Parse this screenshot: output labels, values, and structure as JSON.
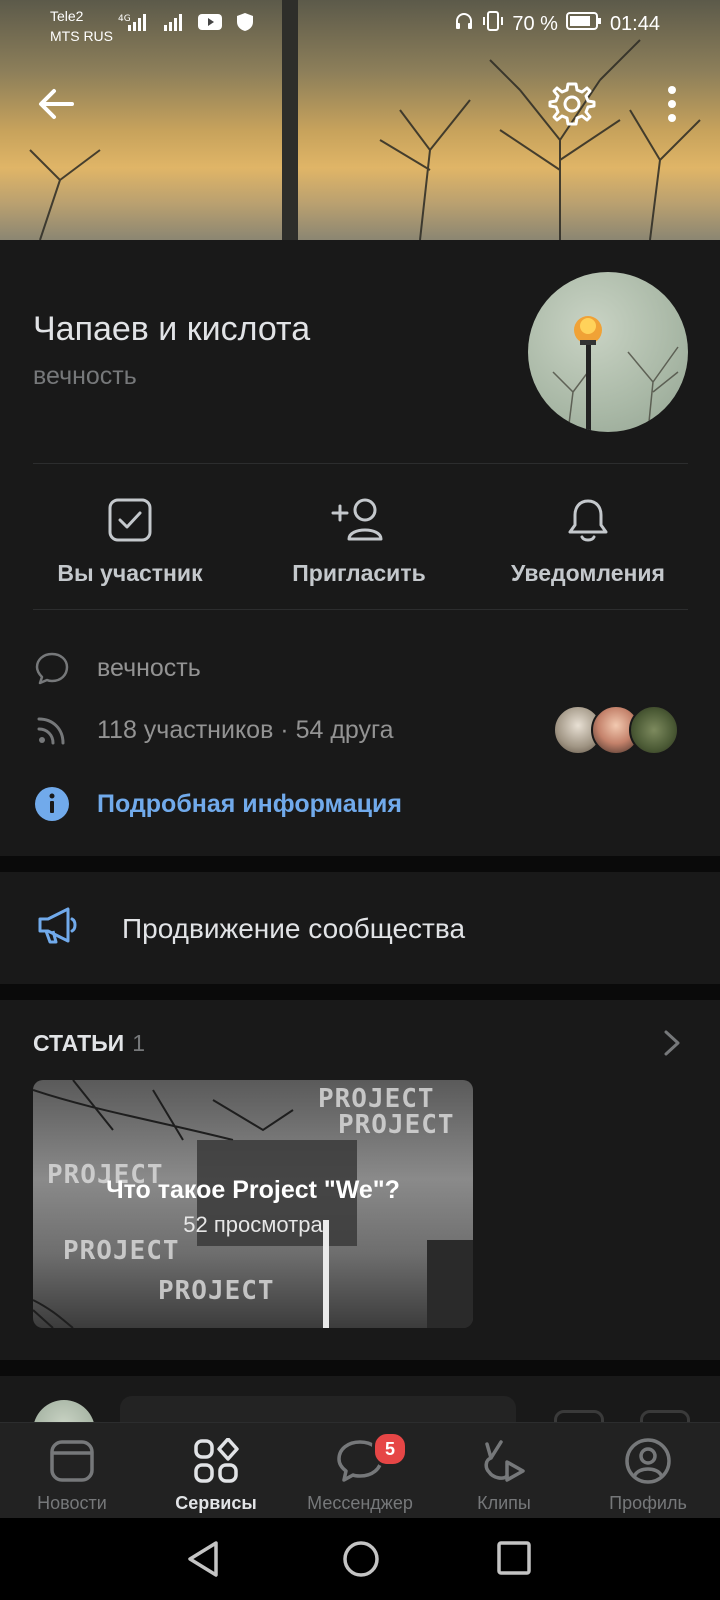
{
  "status_bar": {
    "carrier1": "Tele2",
    "carrier2": "MTS RUS",
    "network": "4G",
    "battery": "70 %",
    "time": "01:44"
  },
  "header": {
    "back_icon": "arrow-left-icon",
    "settings_icon": "gear-icon",
    "more_icon": "more-vertical-icon"
  },
  "group": {
    "name": "Чапаев и кислота",
    "status": "вечность"
  },
  "actions": [
    {
      "label": "Вы участник",
      "icon": "checkbox-icon"
    },
    {
      "label": "Пригласить",
      "icon": "add-user-icon"
    },
    {
      "label": "Уведомления",
      "icon": "bell-icon"
    }
  ],
  "info": {
    "description": "вечность",
    "members": "118 участников · 54 друга",
    "more": "Подробная информация"
  },
  "promo": {
    "label": "Продвижение сообщества"
  },
  "articles": {
    "title": "СТАТЬИ",
    "count": "1",
    "card": {
      "title": "Что такое Project \"We\"?",
      "views": "52 просмотра",
      "background_text": "PROJECT"
    }
  },
  "tabs": [
    {
      "label": "Новости",
      "icon": "news-icon"
    },
    {
      "label": "Сервисы",
      "icon": "services-icon"
    },
    {
      "label": "Мессенджер",
      "icon": "messenger-icon",
      "badge": "5"
    },
    {
      "label": "Клипы",
      "icon": "clips-icon"
    },
    {
      "label": "Профиль",
      "icon": "profile-icon"
    }
  ],
  "colors": {
    "accent": "#71aaeb",
    "badge": "#e64646",
    "panel": "#191919"
  }
}
